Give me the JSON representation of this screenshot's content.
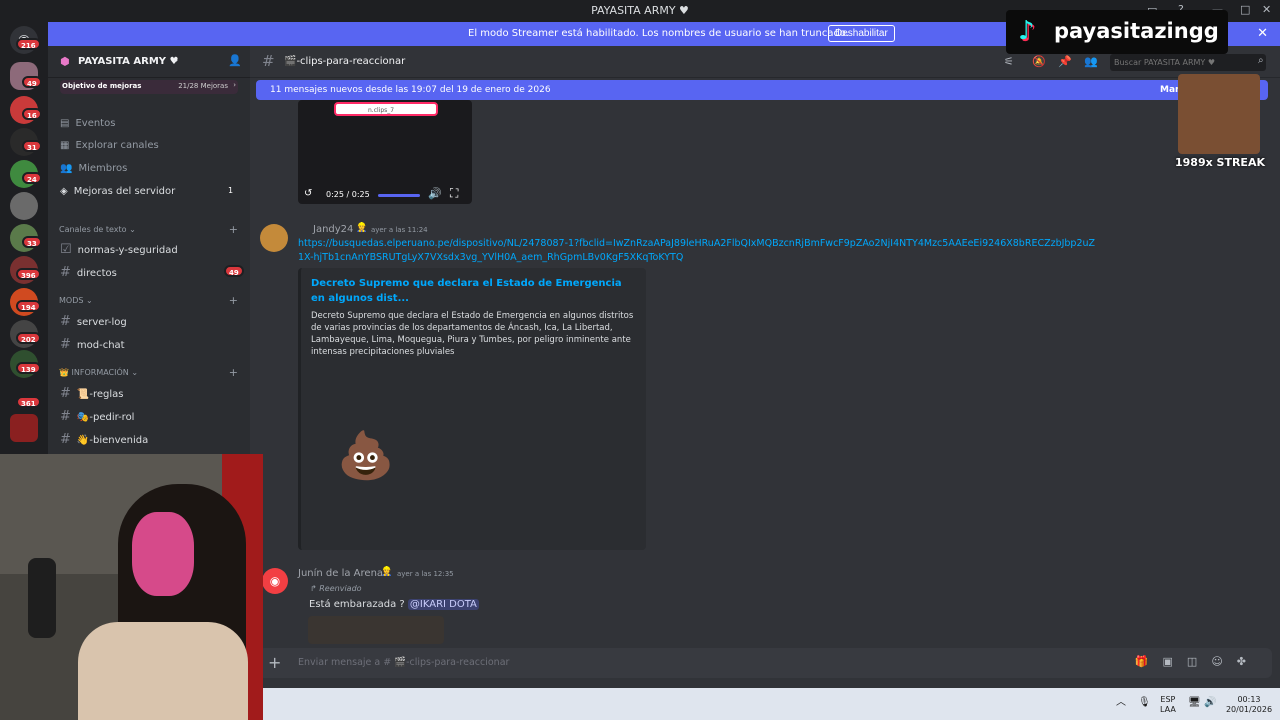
{
  "window": {
    "title": "PAYASITA ARMY ♥"
  },
  "banner": {
    "text": "El modo Streamer está habilitado. Los nombres de usuario se han truncado.",
    "button": "Deshabilitar"
  },
  "rail": {
    "badges": [
      "216",
      "49",
      "16",
      "31",
      "24",
      "33",
      "396",
      "194",
      "202",
      "139",
      "361"
    ]
  },
  "sidebar": {
    "guild_name": "PAYASITA ARMY ♥",
    "boost": {
      "label": "Objetivo de mejoras",
      "count": "21/28 Mejoras"
    },
    "nav": [
      "Eventos",
      "Explorar canales",
      "Miembros",
      "Mejoras del servidor"
    ],
    "boost_badge": "1",
    "categories": {
      "text": "Canales de texto",
      "mods": "MODS",
      "info": "INFORMACIÓN"
    },
    "text_channels": [
      {
        "name": "normas-y-seguridad",
        "badge": ""
      },
      {
        "name": "directos",
        "badge": "49"
      }
    ],
    "mod_channels": [
      "server-log",
      "mod-chat"
    ],
    "info_channels": [
      "📜-reglas",
      "🎭-pedir-rol",
      "👋-bienvenida"
    ]
  },
  "header": {
    "channel": "🎬-clips-para-reaccionar",
    "search_placeholder": "Buscar PAYASITA ARMY ♥"
  },
  "newbar": {
    "text": "11 mensajes nuevos desde las 19:07 del 19 de enero de 2026",
    "action": "Marc"
  },
  "video": {
    "search_text": "n.clips_7",
    "time": "0:25 / 0:25"
  },
  "messages": [
    {
      "author": "Jandy24",
      "time": "ayer a las 11:24",
      "link": "https://busquedas.elperuano.pe/dispositivo/NL/2478087-1?fbclid=IwZnRzaAPaJ89leHRuA2FlbQIxMQBzcnRjBmFwcF9pZAo2NjI4NTY4Mzc5AAEeEi9246X8bRECZzbJbp2uZ1X-hjTb1cnAnYBSRUTgLyX7VXsdx3vg_YVlH0A_aem_RhGpmLBv0KgF5XKqToKYTQ",
      "embed_title": "Decreto Supremo que declara el Estado de Emergencia en algunos dist...",
      "embed_desc": "Decreto Supremo que declara el Estado de Emergencia en algunos distritos de varias provincias de los departamentos de Áncash, Ica, La Libertad, Lambayeque, Lima, Moquegua, Piura y Tumbes, por peligro inminente ante intensas precipitaciones pluviales"
    },
    {
      "author": "Junín de la Arena",
      "time": "ayer a las 12:35",
      "forwarded": "Reenviado",
      "text": "Está embarazada ?",
      "mention": "@IKARI DOTA"
    }
  ],
  "composer": {
    "placeholder": "Enviar mensaje a # 🎬-clips-para-reaccionar"
  },
  "overlay": {
    "tiktok_handle": "payasitazingg",
    "streak": "1989x STREAK"
  },
  "taskbar": {
    "lang1": "ESP",
    "lang2": "LAA",
    "time": "00:13",
    "date": "20/01/2026"
  },
  "colors": {
    "accent": "#5865f2",
    "mention_bg": "#3c4270",
    "badge_red": "#da373c"
  }
}
